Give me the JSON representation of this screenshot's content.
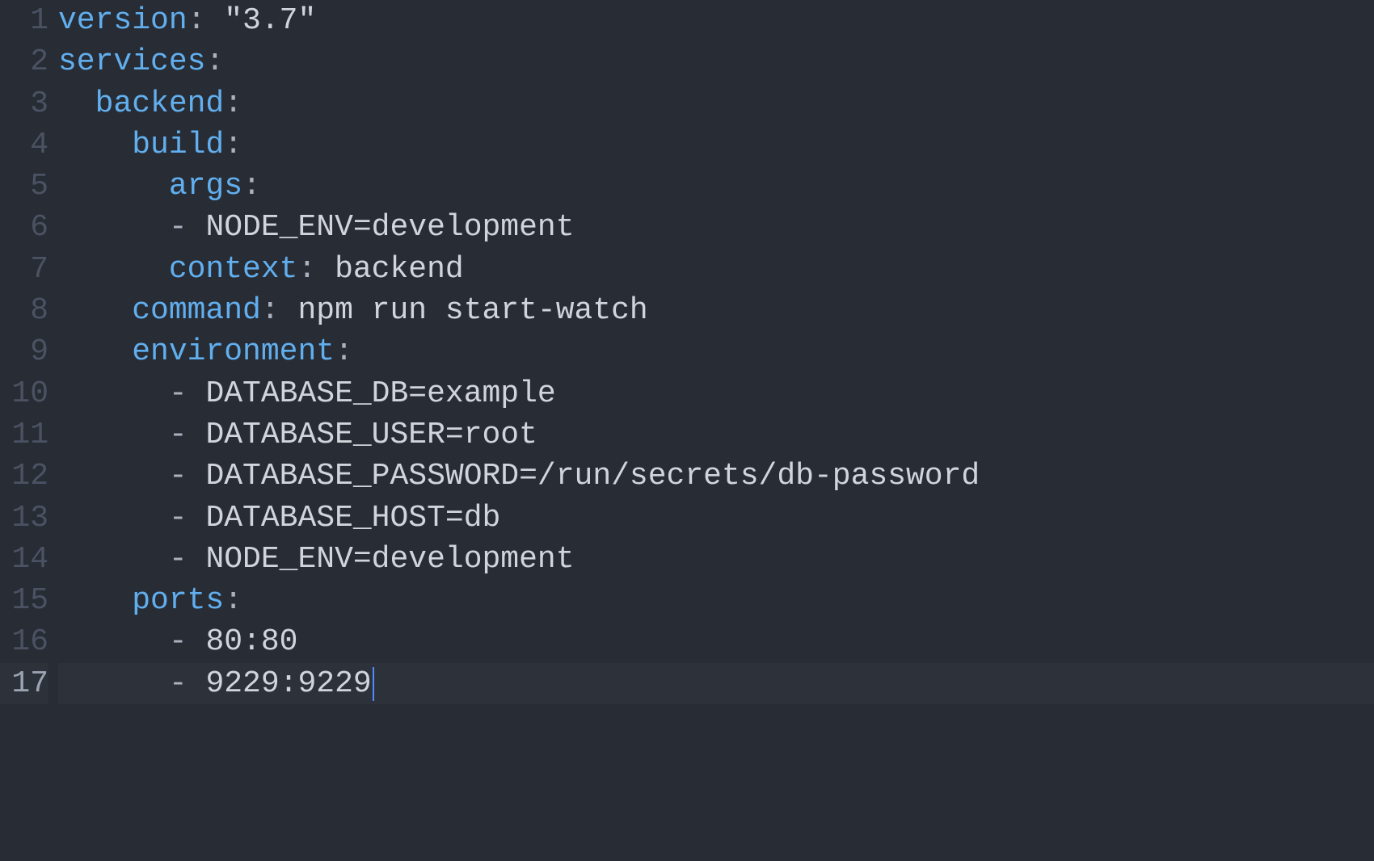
{
  "lines": [
    {
      "num": "1",
      "tokens": [
        [
          "key",
          "version"
        ],
        [
          "punct",
          ": "
        ],
        [
          "string",
          "\"3.7\""
        ]
      ]
    },
    {
      "num": "2",
      "tokens": [
        [
          "key",
          "services"
        ],
        [
          "punct",
          ":"
        ]
      ]
    },
    {
      "num": "3",
      "tokens": [
        [
          "plain",
          "  "
        ],
        [
          "key",
          "backend"
        ],
        [
          "punct",
          ":"
        ]
      ]
    },
    {
      "num": "4",
      "tokens": [
        [
          "plain",
          "    "
        ],
        [
          "key",
          "build"
        ],
        [
          "punct",
          ":"
        ]
      ]
    },
    {
      "num": "5",
      "tokens": [
        [
          "plain",
          "      "
        ],
        [
          "key",
          "args"
        ],
        [
          "punct",
          ":"
        ]
      ]
    },
    {
      "num": "6",
      "tokens": [
        [
          "plain",
          "      "
        ],
        [
          "dash",
          "- "
        ],
        [
          "value",
          "NODE_ENV=development"
        ]
      ]
    },
    {
      "num": "7",
      "tokens": [
        [
          "plain",
          "      "
        ],
        [
          "key",
          "context"
        ],
        [
          "punct",
          ": "
        ],
        [
          "value",
          "backend"
        ]
      ]
    },
    {
      "num": "8",
      "tokens": [
        [
          "plain",
          "    "
        ],
        [
          "key",
          "command"
        ],
        [
          "punct",
          ": "
        ],
        [
          "value",
          "npm run start-watch"
        ]
      ]
    },
    {
      "num": "9",
      "tokens": [
        [
          "plain",
          "    "
        ],
        [
          "key",
          "environment"
        ],
        [
          "punct",
          ":"
        ]
      ]
    },
    {
      "num": "10",
      "tokens": [
        [
          "plain",
          "      "
        ],
        [
          "dash",
          "- "
        ],
        [
          "value",
          "DATABASE_DB=example"
        ]
      ]
    },
    {
      "num": "11",
      "tokens": [
        [
          "plain",
          "      "
        ],
        [
          "dash",
          "- "
        ],
        [
          "value",
          "DATABASE_USER=root"
        ]
      ]
    },
    {
      "num": "12",
      "tokens": [
        [
          "plain",
          "      "
        ],
        [
          "dash",
          "- "
        ],
        [
          "value",
          "DATABASE_PASSWORD=/run/secrets/db-password"
        ]
      ]
    },
    {
      "num": "13",
      "tokens": [
        [
          "plain",
          "      "
        ],
        [
          "dash",
          "- "
        ],
        [
          "value",
          "DATABASE_HOST=db"
        ]
      ]
    },
    {
      "num": "14",
      "tokens": [
        [
          "plain",
          "      "
        ],
        [
          "dash",
          "- "
        ],
        [
          "value",
          "NODE_ENV=development"
        ]
      ]
    },
    {
      "num": "15",
      "tokens": [
        [
          "plain",
          "    "
        ],
        [
          "key",
          "ports"
        ],
        [
          "punct",
          ":"
        ]
      ]
    },
    {
      "num": "16",
      "tokens": [
        [
          "plain",
          "      "
        ],
        [
          "dash",
          "- "
        ],
        [
          "value",
          "80:80"
        ]
      ]
    },
    {
      "num": "17",
      "tokens": [
        [
          "plain",
          "      "
        ],
        [
          "dash",
          "- "
        ],
        [
          "value",
          "9229:9229"
        ]
      ],
      "current": true
    }
  ]
}
